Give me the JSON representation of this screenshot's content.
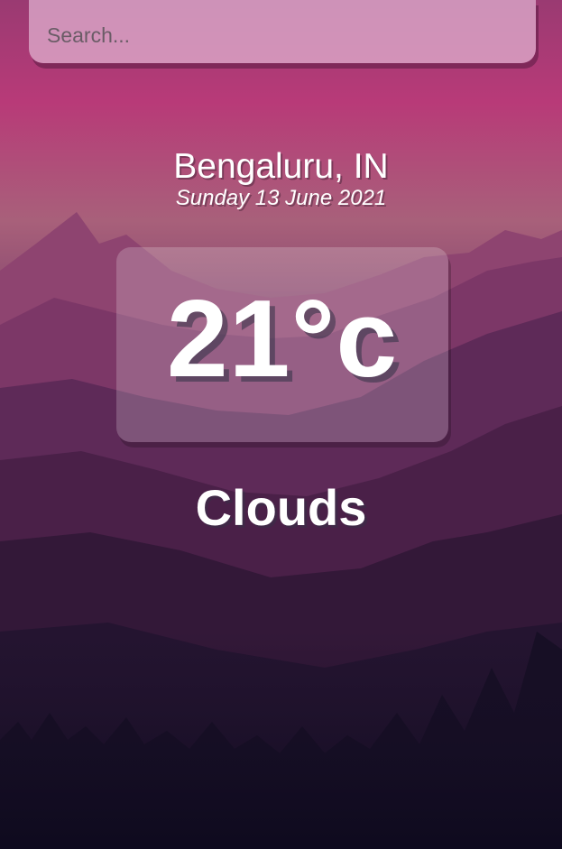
{
  "search": {
    "placeholder": "Search..."
  },
  "location": {
    "city": "Bengaluru, IN",
    "date": "Sunday 13 June 2021"
  },
  "weather": {
    "temperature": "21°c",
    "condition": "Clouds"
  },
  "colors": {
    "sky_top": "#9a3a72",
    "sky_mid": "#b83a78",
    "horizon": "#a8607a",
    "valley_dark": "#120d22"
  }
}
